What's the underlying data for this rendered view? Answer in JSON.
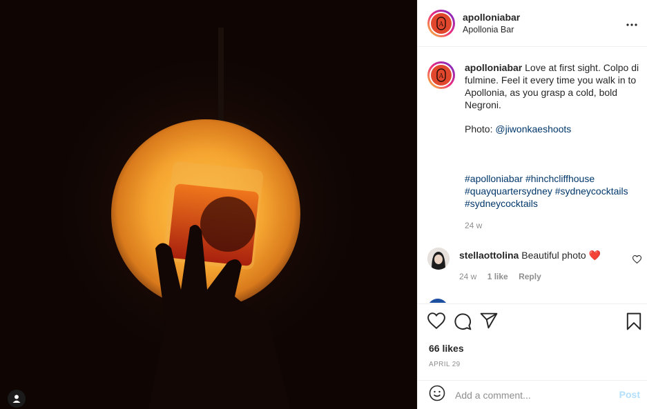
{
  "post": {
    "username": "apolloniabar",
    "display_name": "Apollonia Bar",
    "more_icon": "more-horizontal-icon",
    "avatar_letter": "A"
  },
  "caption": {
    "username": "apolloniabar",
    "text": " Love at first sight. Colpo di fulmine. Feel it every time you walk in to Apollonia, as you grasp a cold, bold Negroni.",
    "photo_prefix": "Photo: ",
    "photo_credit": "@jiwonkaeshoots",
    "hashtags": [
      "#apolloniabar",
      "#hinchcliffhouse",
      "#quayquartersydney",
      "#sydneycocktails",
      "#sydneycocktails"
    ],
    "time": "24 w"
  },
  "comments": [
    {
      "username": "stellaottolina",
      "text": " Beautiful photo ❤️",
      "time": "24 w",
      "likes": "1 like",
      "reply": "Reply"
    }
  ],
  "actions": {
    "like_icon": "heart-icon",
    "comment_icon": "comment-icon",
    "share_icon": "paper-plane-icon",
    "save_icon": "bookmark-icon"
  },
  "likes": "66 likes",
  "date": "APRIL 29",
  "comment_box": {
    "placeholder": "Add a comment...",
    "post_label": "Post",
    "emoji_icon": "smiley-icon"
  },
  "colors": {
    "link": "#00376b",
    "post_disabled": "#b2dffc",
    "logo_red": "#e0472d"
  }
}
